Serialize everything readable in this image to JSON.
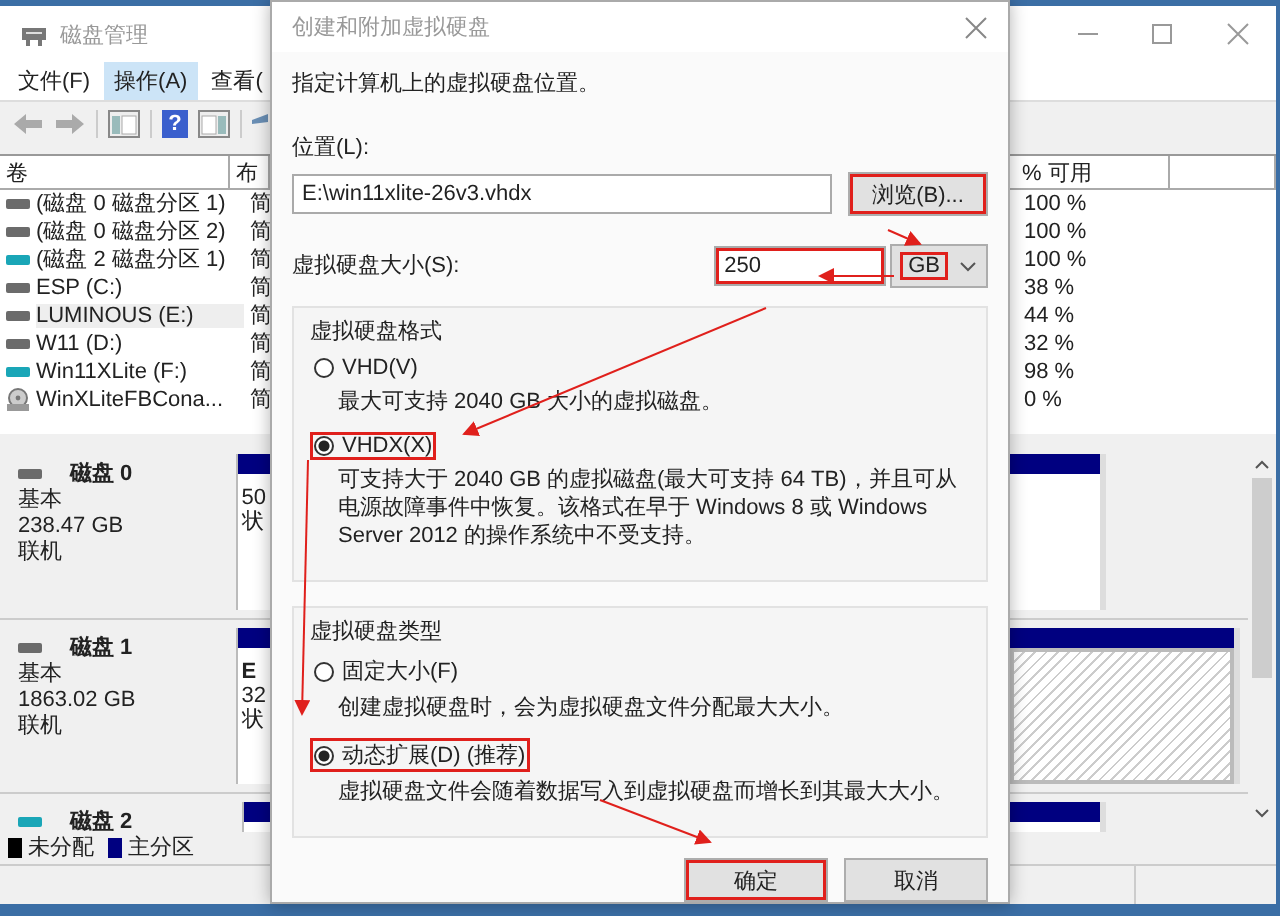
{
  "background_window": {
    "title": "磁盘管理",
    "menu": [
      {
        "label": "文件(F)",
        "selected": false
      },
      {
        "label": "操作(A)",
        "selected": true
      },
      {
        "label": "查看(",
        "selected": false
      }
    ],
    "help_glyph": "?",
    "volume_table": {
      "columns": [
        "卷",
        "布"
      ],
      "rows": [
        {
          "name": "(磁盘 0 磁盘分区 1)",
          "layout": "简",
          "kind": "disk",
          "selected": false
        },
        {
          "name": "(磁盘 0 磁盘分区 2)",
          "layout": "简",
          "kind": "disk",
          "selected": false
        },
        {
          "name": "(磁盘 2 磁盘分区 1)",
          "layout": "简",
          "kind": "usb",
          "selected": false
        },
        {
          "name": "ESP (C:)",
          "layout": "简",
          "kind": "disk",
          "selected": false
        },
        {
          "name": "LUMINOUS (E:)",
          "layout": "简",
          "kind": "disk",
          "selected": true
        },
        {
          "name": "W11 (D:)",
          "layout": "简",
          "kind": "disk",
          "selected": false
        },
        {
          "name": "Win11XLite (F:)",
          "layout": "简",
          "kind": "usb",
          "selected": false
        },
        {
          "name": "WinXLiteFBCona...",
          "layout": "简",
          "kind": "mounted",
          "selected": false
        }
      ]
    },
    "free_table": {
      "columns": [
        "% 可用"
      ],
      "rows": [
        "100 %",
        "100 %",
        "100 %",
        "38 %",
        "44 %",
        "32 %",
        "98 %",
        "0 %"
      ]
    },
    "disks": [
      {
        "name": "磁盘 0",
        "kind": "disk",
        "lines": [
          "基本",
          "238.47 GB",
          "联机"
        ],
        "partition_text": [
          "50",
          "状"
        ],
        "selected": false
      },
      {
        "name": "磁盘 1",
        "kind": "disk",
        "lines": [
          "基本",
          "1863.02 GB",
          "联机"
        ],
        "partition_text": [
          "E",
          "32",
          "状"
        ],
        "selected": true
      },
      {
        "name": "磁盘 2",
        "kind": "usb",
        "selected": false
      }
    ],
    "legend": [
      {
        "label": "未分配",
        "color": "#000000"
      },
      {
        "label": "主分区",
        "color": "#000080"
      }
    ]
  },
  "dialog": {
    "title": "创建和附加虚拟硬盘",
    "instruction": "指定计算机上的虚拟硬盘位置。",
    "location": {
      "label": "位置(L):",
      "value": "E:\\win11xlite-26v3.vhdx"
    },
    "browse_button": {
      "label": "浏览(B)...",
      "highlighted": true
    },
    "size": {
      "label": "虚拟硬盘大小(S):",
      "value": "250",
      "highlighted": true,
      "unit": "GB",
      "unit_highlighted": true
    },
    "format_group": {
      "title": "虚拟硬盘格式",
      "options": [
        {
          "label": "VHD(V)",
          "selected": false,
          "highlighted": false,
          "description": "最大可支持 2040 GB 大小的虚拟磁盘。"
        },
        {
          "label": "VHDX(X)",
          "selected": true,
          "highlighted": true,
          "description": "可支持大于 2040 GB 的虚拟磁盘(最大可支持 64 TB)，并且可从电源故障事件中恢复。该格式在早于 Windows 8 或 Windows Server 2012 的操作系统中不受支持。"
        }
      ]
    },
    "type_group": {
      "title": "虚拟硬盘类型",
      "options": [
        {
          "label": "固定大小(F)",
          "selected": false,
          "highlighted": false,
          "description": "创建虚拟硬盘时，会为虚拟硬盘文件分配最大大小。"
        },
        {
          "label": "动态扩展(D) (推荐)",
          "selected": true,
          "highlighted": true,
          "description": "虚拟硬盘文件会随着数据写入到虚拟硬盘而增长到其最大大小。"
        }
      ]
    },
    "buttons": [
      {
        "label": "确定",
        "highlighted": true
      },
      {
        "label": "取消",
        "highlighted": false
      }
    ]
  }
}
